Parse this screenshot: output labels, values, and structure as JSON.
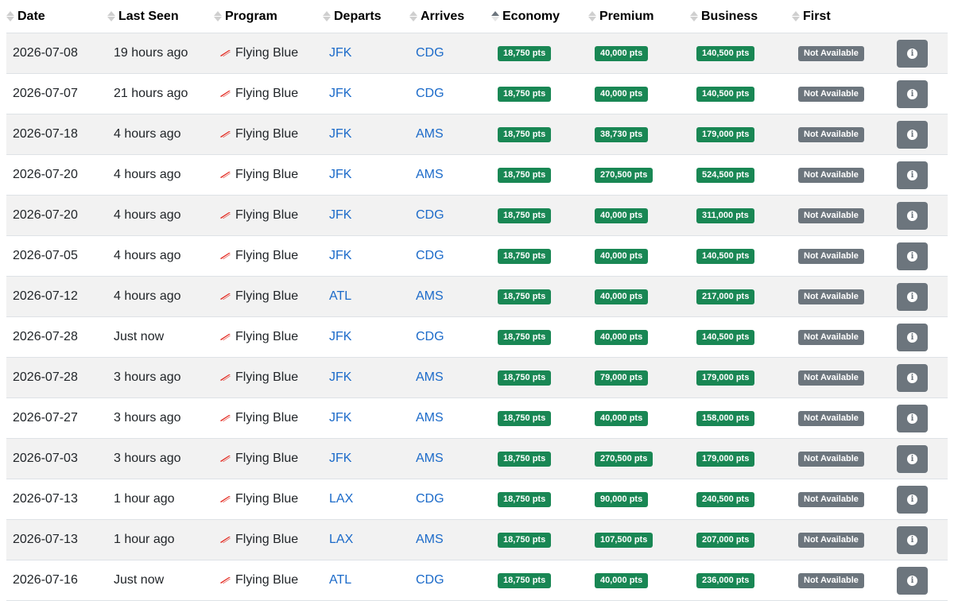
{
  "columns": [
    {
      "key": "date",
      "label": "Date",
      "sort": "none"
    },
    {
      "key": "last_seen",
      "label": "Last Seen",
      "sort": "none"
    },
    {
      "key": "program",
      "label": "Program",
      "sort": "none"
    },
    {
      "key": "departs",
      "label": "Departs",
      "sort": "none"
    },
    {
      "key": "arrives",
      "label": "Arrives",
      "sort": "none"
    },
    {
      "key": "economy",
      "label": "Economy",
      "sort": "asc"
    },
    {
      "key": "premium",
      "label": "Premium",
      "sort": "none"
    },
    {
      "key": "business",
      "label": "Business",
      "sort": "none"
    },
    {
      "key": "first",
      "label": "First",
      "sort": "none"
    }
  ],
  "colors": {
    "available": "#198754",
    "unavailable": "#6c757d",
    "link": "#1b6ac9",
    "logo_red": "#e2231a"
  },
  "icons": {
    "program_logo": "airline-logo-icon",
    "details": "info-icon"
  },
  "rows": [
    {
      "date": "2026-07-08",
      "last_seen": "19 hours ago",
      "program": "Flying Blue",
      "departs": "JFK",
      "arrives": "CDG",
      "economy": "18,750 pts",
      "premium": "40,000 pts",
      "business": "140,500 pts",
      "first": "Not Available"
    },
    {
      "date": "2026-07-07",
      "last_seen": "21 hours ago",
      "program": "Flying Blue",
      "departs": "JFK",
      "arrives": "CDG",
      "economy": "18,750 pts",
      "premium": "40,000 pts",
      "business": "140,500 pts",
      "first": "Not Available"
    },
    {
      "date": "2026-07-18",
      "last_seen": "4 hours ago",
      "program": "Flying Blue",
      "departs": "JFK",
      "arrives": "AMS",
      "economy": "18,750 pts",
      "premium": "38,730 pts",
      "business": "179,000 pts",
      "first": "Not Available"
    },
    {
      "date": "2026-07-20",
      "last_seen": "4 hours ago",
      "program": "Flying Blue",
      "departs": "JFK",
      "arrives": "AMS",
      "economy": "18,750 pts",
      "premium": "270,500 pts",
      "business": "524,500 pts",
      "first": "Not Available"
    },
    {
      "date": "2026-07-20",
      "last_seen": "4 hours ago",
      "program": "Flying Blue",
      "departs": "JFK",
      "arrives": "CDG",
      "economy": "18,750 pts",
      "premium": "40,000 pts",
      "business": "311,000 pts",
      "first": "Not Available"
    },
    {
      "date": "2026-07-05",
      "last_seen": "4 hours ago",
      "program": "Flying Blue",
      "departs": "JFK",
      "arrives": "CDG",
      "economy": "18,750 pts",
      "premium": "40,000 pts",
      "business": "140,500 pts",
      "first": "Not Available"
    },
    {
      "date": "2026-07-12",
      "last_seen": "4 hours ago",
      "program": "Flying Blue",
      "departs": "ATL",
      "arrives": "AMS",
      "economy": "18,750 pts",
      "premium": "40,000 pts",
      "business": "217,000 pts",
      "first": "Not Available"
    },
    {
      "date": "2026-07-28",
      "last_seen": "Just now",
      "program": "Flying Blue",
      "departs": "JFK",
      "arrives": "CDG",
      "economy": "18,750 pts",
      "premium": "40,000 pts",
      "business": "140,500 pts",
      "first": "Not Available"
    },
    {
      "date": "2026-07-28",
      "last_seen": "3 hours ago",
      "program": "Flying Blue",
      "departs": "JFK",
      "arrives": "AMS",
      "economy": "18,750 pts",
      "premium": "79,000 pts",
      "business": "179,000 pts",
      "first": "Not Available"
    },
    {
      "date": "2026-07-27",
      "last_seen": "3 hours ago",
      "program": "Flying Blue",
      "departs": "JFK",
      "arrives": "AMS",
      "economy": "18,750 pts",
      "premium": "40,000 pts",
      "business": "158,000 pts",
      "first": "Not Available"
    },
    {
      "date": "2026-07-03",
      "last_seen": "3 hours ago",
      "program": "Flying Blue",
      "departs": "JFK",
      "arrives": "AMS",
      "economy": "18,750 pts",
      "premium": "270,500 pts",
      "business": "179,000 pts",
      "first": "Not Available"
    },
    {
      "date": "2026-07-13",
      "last_seen": "1 hour ago",
      "program": "Flying Blue",
      "departs": "LAX",
      "arrives": "CDG",
      "economy": "18,750 pts",
      "premium": "90,000 pts",
      "business": "240,500 pts",
      "first": "Not Available"
    },
    {
      "date": "2026-07-13",
      "last_seen": "1 hour ago",
      "program": "Flying Blue",
      "departs": "LAX",
      "arrives": "AMS",
      "economy": "18,750 pts",
      "premium": "107,500 pts",
      "business": "207,000 pts",
      "first": "Not Available"
    },
    {
      "date": "2026-07-16",
      "last_seen": "Just now",
      "program": "Flying Blue",
      "departs": "ATL",
      "arrives": "CDG",
      "economy": "18,750 pts",
      "premium": "40,000 pts",
      "business": "236,000 pts",
      "first": "Not Available"
    }
  ]
}
